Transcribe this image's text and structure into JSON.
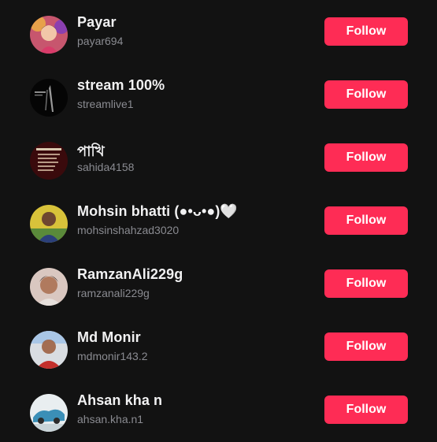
{
  "follow_label": "Follow",
  "accent_color": "#fe2c55",
  "users": [
    {
      "name": "Payar",
      "handle": "payar694"
    },
    {
      "name": "stream 100%",
      "handle": "streamlive1"
    },
    {
      "name": "পাখি",
      "handle": "sahida4158"
    },
    {
      "name": "Mohsin bhatti (●•ᴗ•●)🤍",
      "handle": "mohsinshahzad3020"
    },
    {
      "name": "RamzanAli229g",
      "handle": "ramzanali229g"
    },
    {
      "name": "Md Monir",
      "handle": "mdmonir143.2"
    },
    {
      "name": "Ahsan kha n",
      "handle": "ahsan.kha.n1"
    }
  ]
}
